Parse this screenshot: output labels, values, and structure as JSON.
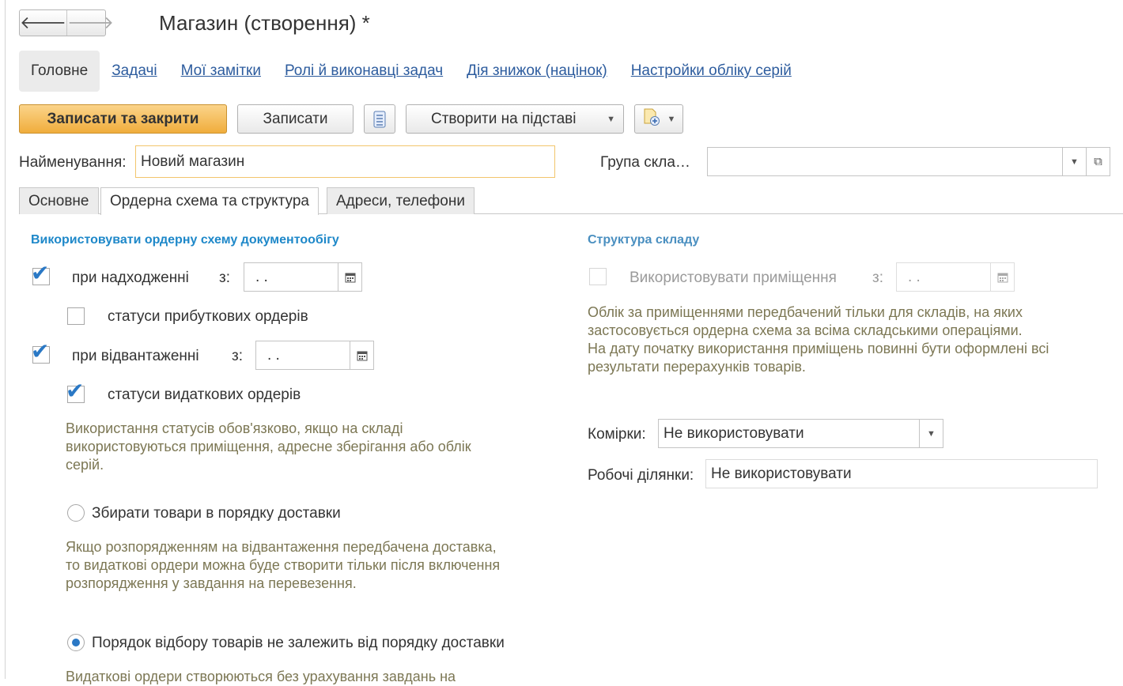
{
  "window": {
    "title": "Магазин (створення) *"
  },
  "nav": {
    "back_glyph": "🡐",
    "forward_glyph": "🡒"
  },
  "sections": [
    {
      "label": "Головне"
    },
    {
      "label": "Задачі"
    },
    {
      "label": "Мої замітки"
    },
    {
      "label": "Ролі й виконавці задач"
    },
    {
      "label": "Дія знижок (націнок)"
    },
    {
      "label": "Настройки обліку серій"
    }
  ],
  "toolbar": {
    "save_close_label": "Записати та закрити",
    "save_label": "Записати",
    "create_based_label": "Створити на підставі",
    "list_icon": "list-icon",
    "attach_icon": "document-add-icon"
  },
  "fields": {
    "name_label": "Найменування:",
    "name_value": "Новий магазин",
    "group_label": "Група скла…",
    "group_value": ""
  },
  "tabs": [
    {
      "label": "Основне"
    },
    {
      "label": "Ордерна схема та структура"
    },
    {
      "label": "Адреси, телефони"
    }
  ],
  "order_scheme": {
    "heading": "Використовувати ордерну схему документообігу",
    "receipt": {
      "label": "при надходженні",
      "checked": true,
      "date_label": "з:",
      "date_value": " .  . "
    },
    "receipt_statuses": {
      "label": "статуси прибуткових ордерів",
      "checked": false
    },
    "shipment": {
      "label": "при відвантаженні",
      "checked": true,
      "date_label": "з:",
      "date_value": " .  . "
    },
    "shipment_statuses": {
      "label": "статуси видаткових ордерів",
      "checked": true
    },
    "statuses_note": [
      "Використання статусів обов'язково, якщо на складі",
      "використовуються приміщення, адресне зберігання або облік",
      "серій."
    ],
    "radio_delivery": {
      "label": "Збирати товари в порядку доставки",
      "selected": false
    },
    "delivery_note": [
      "Якщо розпорядженням на відвантаження передбачена доставка,",
      "то видаткові ордери можна буде створити тільки після включення",
      "розпорядження у завдання на перевезення."
    ],
    "radio_independent": {
      "label": "Порядок відбору товарів не залежить від порядку доставки",
      "selected": true
    },
    "independent_note": "Видаткові ордери створюються без урахування завдань на"
  },
  "warehouse_structure": {
    "heading": "Структура складу",
    "use_premises": {
      "label": "Використовувати приміщення",
      "checked": false,
      "date_label": "з:",
      "date_value": " .  . "
    },
    "premises_note": [
      "Облік за приміщеннями передбачений тільки для складів, на яких",
      "застосовується ордерна схема за всіма складськими операціями.",
      "На дату початку використання приміщень повинні бути оформлені всі",
      "результати перерахунків товарів."
    ],
    "cells_label": "Комірки:",
    "cells_value": "Не використовувати",
    "work_areas_label": "Робочі ділянки:",
    "work_areas_value": "Не використовувати"
  }
}
